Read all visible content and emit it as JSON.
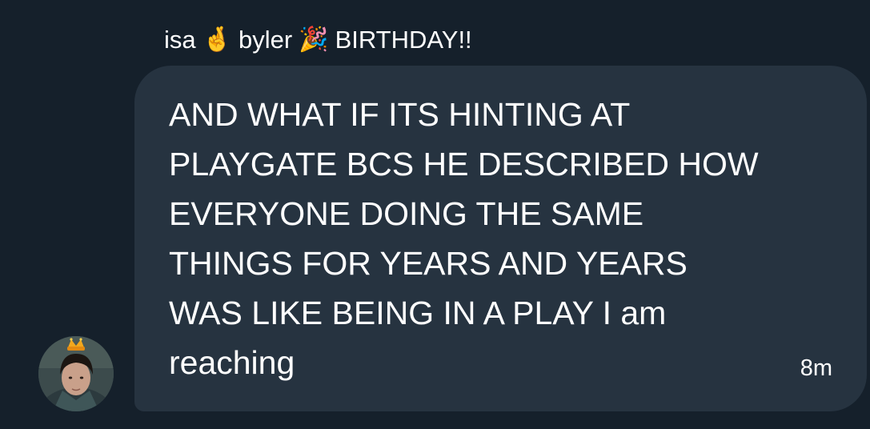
{
  "conversation": {
    "sender": {
      "name_part1": "isa",
      "emoji1": "🤞",
      "name_part2": "byler",
      "emoji2": "🎉",
      "name_part3": "BIRTHDAY!!"
    },
    "message": {
      "text": "AND WHAT IF ITS HINTING AT\nPLAYGATE BCS HE DESCRIBED HOW\nEVERYONE DOING THE SAME\nTHINGS FOR YEARS AND YEARS\nWAS LIKE BEING IN A PLAY  I am\nreaching",
      "timestamp": "8m"
    },
    "avatar": {
      "icon": "user-avatar-photo"
    }
  },
  "colors": {
    "background": "#15202b",
    "bubble": "#263340",
    "text": "#ffffff"
  }
}
